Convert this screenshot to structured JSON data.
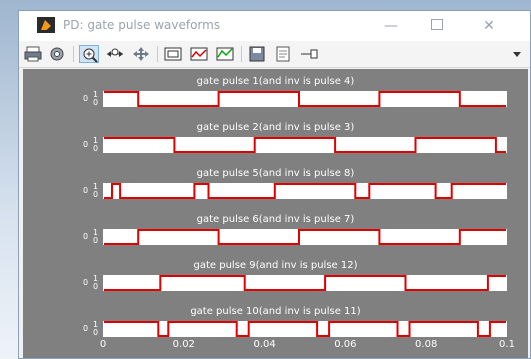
{
  "window": {
    "title": "PD: gate pulse waveforms",
    "controls": {
      "minimize": "—",
      "close": "✕"
    }
  },
  "toolbar": {
    "icons": [
      "print-icon",
      "settings-icon",
      "zoom-in-icon",
      "zoom-x-icon",
      "pan-icon",
      "fit-to-view-icon",
      "zoom-y-icon",
      "autoscale-icon",
      "save-axes-icon",
      "print-preview-icon",
      "cursor-icon",
      "dropdown-icon"
    ]
  },
  "colors": {
    "trace": "#e00000",
    "axes_bg": "#ffffff",
    "figure_bg": "#808080"
  },
  "chart_data": [
    {
      "type": "line",
      "title": "gate pulse 1(and inv is pulse 4)",
      "ylim": [
        0,
        1
      ],
      "yticks": [
        "1",
        "0"
      ],
      "xlim": [
        0,
        0.1
      ],
      "series": [
        {
          "x": [
            0,
            0.0085,
            0.0085,
            0.0285,
            0.0285,
            0.0485,
            0.0485,
            0.0685,
            0.0685,
            0.0885,
            0.0885,
            0.1
          ],
          "y": [
            1,
            1,
            0,
            0,
            1,
            1,
            0,
            0,
            1,
            1,
            0,
            0
          ]
        }
      ]
    },
    {
      "type": "line",
      "title": "gate pulse 2(and inv is pulse 3)",
      "ylim": [
        0,
        1
      ],
      "yticks": [
        "1",
        "0"
      ],
      "xlim": [
        0,
        0.1
      ],
      "series": [
        {
          "x": [
            0,
            0.0175,
            0.0175,
            0.0375,
            0.0375,
            0.0575,
            0.0575,
            0.0775,
            0.0775,
            0.0975,
            0.0975,
            0.1
          ],
          "y": [
            1,
            1,
            0,
            0,
            1,
            1,
            0,
            0,
            1,
            1,
            0,
            0
          ]
        }
      ]
    },
    {
      "type": "line",
      "title": "gate pulse 5(and inv is pulse 8)",
      "ylim": [
        0,
        1
      ],
      "yticks": [
        "1",
        "0"
      ],
      "xlim": [
        0,
        0.1
      ],
      "series": [
        {
          "x": [
            0,
            0.002,
            0.002,
            0.004,
            0.004,
            0.0225,
            0.0225,
            0.026,
            0.026,
            0.0425,
            0.0425,
            0.0625,
            0.0625,
            0.066,
            0.066,
            0.0825,
            0.0825,
            0.0865,
            0.0865,
            0.1
          ],
          "y": [
            0,
            0,
            1,
            1,
            0,
            0,
            1,
            1,
            0,
            0,
            1,
            1,
            0,
            0,
            1,
            1,
            0,
            0,
            1,
            1
          ]
        }
      ]
    },
    {
      "type": "line",
      "title": "gate pulse 6(and inv is pulse 7)",
      "ylim": [
        0,
        1
      ],
      "yticks": [
        "1",
        "0"
      ],
      "xlim": [
        0,
        0.1
      ],
      "series": [
        {
          "x": [
            0,
            0.0085,
            0.0085,
            0.0285,
            0.0285,
            0.0485,
            0.0485,
            0.0685,
            0.0685,
            0.0885,
            0.0885,
            0.1
          ],
          "y": [
            0,
            0,
            1,
            1,
            0,
            0,
            1,
            1,
            0,
            0,
            1,
            1
          ]
        }
      ]
    },
    {
      "type": "line",
      "title": "gate pulse 9(and inv is pulse 12)",
      "ylim": [
        0,
        1
      ],
      "yticks": [
        "1",
        "0"
      ],
      "xlim": [
        0,
        0.1
      ],
      "series": [
        {
          "x": [
            0,
            0.014,
            0.014,
            0.035,
            0.035,
            0.055,
            0.055,
            0.075,
            0.075,
            0.0955,
            0.0955,
            0.1
          ],
          "y": [
            0,
            0,
            1,
            1,
            0,
            0,
            1,
            1,
            0,
            0,
            1,
            1
          ]
        }
      ]
    },
    {
      "type": "line",
      "title": "gate pulse 10(and inv is pulse 11)",
      "ylim": [
        0,
        1
      ],
      "yticks": [
        "1",
        "0"
      ],
      "xlim": [
        0,
        0.1
      ],
      "xticks": [
        "0",
        "0.02",
        "0.04",
        "0.06",
        "0.08",
        "0.1"
      ],
      "series": [
        {
          "x": [
            0,
            0.0135,
            0.0135,
            0.016,
            0.016,
            0.033,
            0.033,
            0.036,
            0.036,
            0.053,
            0.053,
            0.056,
            0.056,
            0.073,
            0.073,
            0.076,
            0.076,
            0.093,
            0.093,
            0.096,
            0.096,
            0.1
          ],
          "y": [
            1,
            1,
            0,
            0,
            1,
            1,
            0,
            0,
            1,
            1,
            0,
            0,
            1,
            1,
            0,
            0,
            1,
            1,
            0,
            0,
            1,
            1
          ]
        }
      ]
    }
  ]
}
